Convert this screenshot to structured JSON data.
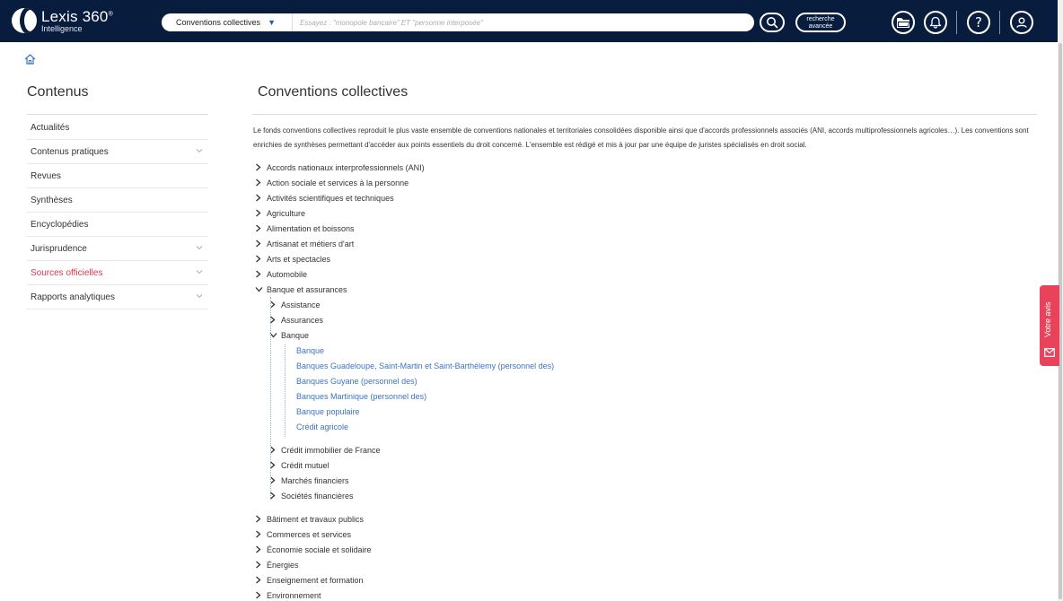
{
  "header": {
    "logo_name": "Lexis 360",
    "logo_sup": "®",
    "logo_sub": "Intelligence",
    "search_scope": "Conventions collectives",
    "search_placeholder": "Essayez : \"monopole bancaire\" ET \"personne interposée\"",
    "advanced_search_line1": "recherche",
    "advanced_search_line2": "avancée"
  },
  "sidebar": {
    "title": "Contenus",
    "items": [
      {
        "label": "Actualités",
        "expandable": false,
        "active": false
      },
      {
        "label": "Contenus pratiques",
        "expandable": true,
        "active": false
      },
      {
        "label": "Revues",
        "expandable": false,
        "active": false
      },
      {
        "label": "Synthèses",
        "expandable": false,
        "active": false
      },
      {
        "label": "Encyclopédies",
        "expandable": false,
        "active": false
      },
      {
        "label": "Jurisprudence",
        "expandable": true,
        "active": false
      },
      {
        "label": "Sources officielles",
        "expandable": true,
        "active": true
      },
      {
        "label": "Rapports analytiques",
        "expandable": true,
        "active": false
      }
    ]
  },
  "main": {
    "title": "Conventions collectives",
    "intro": "Le fonds conventions collectives reproduit le plus vaste ensemble de conventions nationales et territoriales consolidées disponible ainsi que d'accords professionnels associés (ANI, accords multiprofessionnels agricoles…). Les conventions sont enrichies de synthèses permettant d'accéder aux points essentiels du droit concerné. L'ensemble est rédigé et mis à jour par une équipe de juristes spécialisés en droit social.",
    "tree_top": [
      "Accords nationaux interprofessionnels (ANI)",
      "Action sociale et services à la personne",
      "Activités scientifiques et techniques",
      "Agriculture",
      "Alimentation et boissons",
      "Artisanat et métiers d'art",
      "Arts et spectacles",
      "Automobile"
    ],
    "expanded": "Banque et assurances",
    "sub_before": [
      "Assistance",
      "Assurances"
    ],
    "sub_expanded": "Banque",
    "leaves": [
      "Banque",
      "Banques Guadeloupe, Saint-Martin et Saint-Barthélemy (personnel des)",
      "Banques Guyane (personnel des)",
      "Banques Martinique (personnel des)",
      "Banque populaire",
      "Crédit agricole"
    ],
    "sub_after": [
      "Crédit immobilier de France",
      "Crédit mutuel",
      "Marchés financiers",
      "Sociétés financières"
    ],
    "tree_bottom": [
      "Bâtiment et travaux publics",
      "Commerces et services",
      "Économie sociale et solidaire",
      "Énergies",
      "Enseignement et formation",
      "Environnement"
    ]
  },
  "feedback": {
    "label": "Votre avis"
  },
  "colors": {
    "topbar": "#081c3d",
    "active": "#d9374b",
    "link": "#3b74c1",
    "feedback": "#e8435a"
  }
}
